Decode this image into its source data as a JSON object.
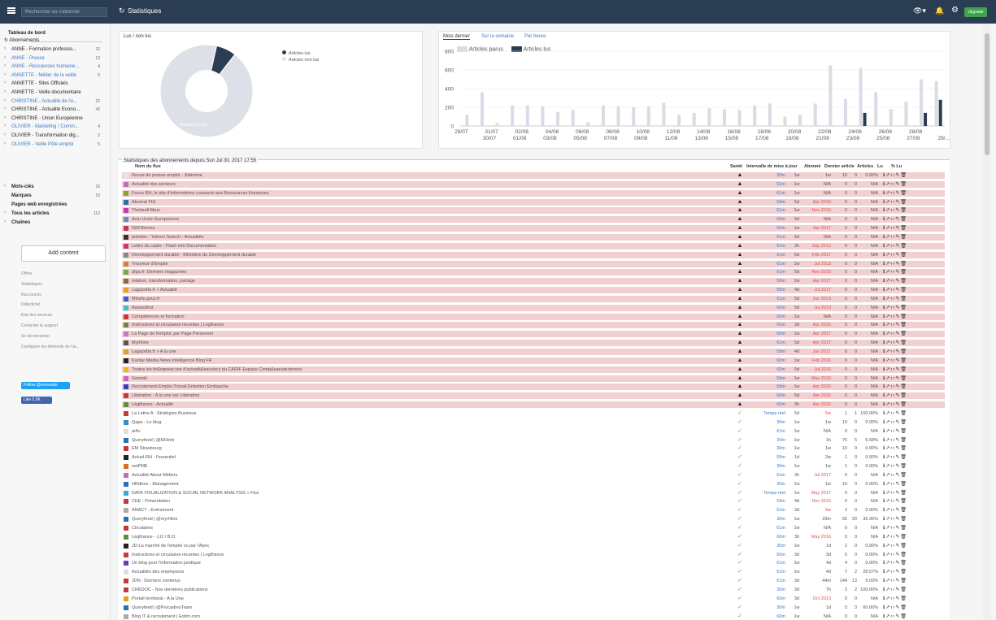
{
  "topbar": {
    "search_placeholder": "Rechercher ou s'abonner",
    "title": "Statistiques",
    "upgrade": "Upgrade"
  },
  "sidebar": {
    "dashboard": "Tableau de bord",
    "subscriptions": "Abonnements",
    "items": [
      {
        "label": "ANNE - Formation professio...",
        "count": "12",
        "style": "dark"
      },
      {
        "label": "ANNE - Presse",
        "count": "12",
        "style": "blue"
      },
      {
        "label": "ANNE - Ressources humaine...",
        "count": "4",
        "style": "blue"
      },
      {
        "label": "ANNETTE - Métier de la veille",
        "count": "5",
        "style": "blue"
      },
      {
        "label": "ANNETTE - Sites Officiels",
        "count": "",
        "style": "dark"
      },
      {
        "label": "ANNETTE - Veille documentaire",
        "count": "",
        "style": "dark"
      },
      {
        "label": "CHRISTINE - Actualité de l'e...",
        "count": "22",
        "style": "blue"
      },
      {
        "label": "CHRISTINE - Actualité Econo...",
        "count": "42",
        "style": "dark"
      },
      {
        "label": "CHRISTINE - Union Européenne",
        "count": "",
        "style": "dark"
      },
      {
        "label": "OLIVIER - Marketing / Comm...",
        "count": "4",
        "style": "blue"
      },
      {
        "label": "OLIVIER - Transformation dig...",
        "count": "2",
        "style": "dark"
      },
      {
        "label": "OLIVIER - Veille Pôle emploi",
        "count": "5",
        "style": "blue"
      }
    ],
    "keywords": "Mots-clés",
    "keywords_count": "16",
    "marks": "Marques",
    "marks_count": "10",
    "saved_pages": "Pages web enregistrées",
    "all_articles": "Tous les articles",
    "all_articles_count": "112",
    "channels": "Chaînes",
    "add_content": "Add content",
    "links": [
      "Offres",
      "Statistiques",
      "Raccourcis",
      "Didacticiel",
      "Etat des services",
      "Contacter le support",
      "Se déconnecter",
      "Configurer les éléments de l'ar..."
    ],
    "twitter": "Follow @inoreader",
    "facebook": "Like 5.9K"
  },
  "pie_panel": {
    "tab": "Lus / non lus",
    "legend_read": "Articles lus",
    "legend_unread": "Articles non lus",
    "slice_label": "Articles non lus",
    "colors": {
      "read": "#2b3d53",
      "unread": "#dde1e7"
    }
  },
  "bar_panel": {
    "tabs": [
      "Mois dernier",
      "Sur la semaine",
      "Par heure"
    ],
    "legend_published": "Articles parus",
    "legend_read": "Articles lus",
    "colors": {
      "published": "#d8dde5",
      "read": "#2b3d53"
    }
  },
  "chart_data": [
    {
      "type": "pie",
      "labels": [
        "Articles lus",
        "Articles non lus"
      ],
      "values": [
        7,
        93
      ]
    },
    {
      "type": "bar",
      "categories": [
        "29/07",
        "30/07",
        "31/07",
        "01/08",
        "02/08",
        "03/08",
        "04/08",
        "05/08",
        "06/08",
        "07/08",
        "08/08",
        "09/08",
        "10/08",
        "11/08",
        "12/08",
        "13/08",
        "14/08",
        "15/08",
        "16/08",
        "17/08",
        "18/08",
        "19/08",
        "20/08",
        "21/08",
        "22/08",
        "23/08",
        "24/08",
        "25/08",
        "26/08",
        "27/08",
        "28/08",
        "29/..."
      ],
      "ylim": [
        0,
        800
      ],
      "yticks": [
        0,
        200,
        400,
        600,
        800
      ],
      "series": [
        {
          "name": "Articles parus",
          "values": [
            120,
            360,
            30,
            220,
            220,
            210,
            150,
            170,
            40,
            220,
            210,
            200,
            210,
            250,
            120,
            140,
            190,
            180,
            170,
            220,
            240,
            100,
            120,
            240,
            650,
            290,
            620,
            360,
            180,
            260,
            500,
            480
          ]
        },
        {
          "name": "Articles lus",
          "values": [
            0,
            0,
            0,
            0,
            0,
            0,
            0,
            0,
            0,
            0,
            0,
            0,
            0,
            0,
            0,
            0,
            0,
            0,
            0,
            0,
            0,
            0,
            0,
            0,
            0,
            0,
            140,
            0,
            0,
            0,
            140,
            280
          ]
        }
      ]
    }
  ],
  "table": {
    "title": "Statistiques des abonnements depuis Sun Jul 30, 2017 17:55",
    "headers": {
      "name": "Nom du flux",
      "health": "Santé",
      "interval": "Intervalle de mise à jour",
      "sub": "Abonné",
      "last": "Dernier article",
      "articles": "Articles",
      "read": "Lu",
      "pct": "% Lu"
    },
    "rows": [
      {
        "name": "Revue de presse emploi - Jobintree",
        "health": "bad",
        "interval": "30m",
        "ab": "1w",
        "last": "1w",
        "last_red": false,
        "art": "10",
        "lu": "0",
        "pct": "0.00%",
        "icon": "#e6e6e6"
      },
      {
        "name": "Actualité des secteurs",
        "health": "bad",
        "interval": "61m",
        "ab": "1w",
        "last": "N/A",
        "last_red": false,
        "art": "0",
        "lu": "0",
        "pct": "N/A",
        "icon": "#c468c4"
      },
      {
        "name": "Focus RH, le site d'informations consacré aux Ressources Humaines",
        "health": "bad",
        "interval": "61m",
        "ab": "1w",
        "last": "N/A",
        "last_red": false,
        "art": "0",
        "lu": "0",
        "pct": "N/A",
        "icon": "#8a9f3a"
      },
      {
        "name": "Abonné FIG",
        "health": "bad",
        "interval": "59m",
        "ab": "5d",
        "last": "Apr 2016",
        "last_red": true,
        "art": "0",
        "lu": "0",
        "pct": "N/A",
        "icon": "#2a6fb5"
      },
      {
        "name": "Thebault Marc",
        "health": "bad",
        "interval": "61m",
        "ab": "1w",
        "last": "Nov 2016",
        "last_red": true,
        "art": "0",
        "lu": "0",
        "pct": "N/A",
        "icon": "#c43aa8"
      },
      {
        "name": "Actu Union Européenne",
        "health": "bad",
        "interval": "60m",
        "ab": "5d",
        "last": "N/A",
        "last_red": false,
        "art": "0",
        "lu": "0",
        "pct": "N/A",
        "icon": "#5b8fc5"
      },
      {
        "name": "ISM Brèves",
        "health": "bad",
        "interval": "60m",
        "ab": "1w",
        "last": "Jan 2017",
        "last_red": true,
        "art": "0",
        "lu": "0",
        "pct": "N/A",
        "icon": "#c43a4a"
      },
      {
        "name": "poledoc - Yahoo! Search - Actualités",
        "health": "bad",
        "interval": "61m",
        "ab": "5d",
        "last": "N/A",
        "last_red": false,
        "art": "0",
        "lu": "0",
        "pct": "N/A",
        "icon": "#333333"
      },
      {
        "name": "Lettre du cadre - Flash info Documentation",
        "health": "bad",
        "interval": "61m",
        "ab": "2h",
        "last": "Sep 2013",
        "last_red": true,
        "art": "0",
        "lu": "0",
        "pct": "N/A",
        "icon": "#c43a6a"
      },
      {
        "name": "Développement durable - Ministère du Développement durable",
        "health": "bad",
        "interval": "61m",
        "ab": "5d",
        "last": "Feb 2017",
        "last_red": true,
        "art": "0",
        "lu": "0",
        "pct": "N/A",
        "icon": "#888888"
      },
      {
        "name": "Trouveur d'Emploi",
        "health": "bad",
        "interval": "61m",
        "ab": "1w",
        "last": "Jul 2013",
        "last_red": true,
        "art": "0",
        "lu": "0",
        "pct": "N/A",
        "icon": "#c48a3a"
      },
      {
        "name": "afpa.fr: Derniers magazines",
        "health": "bad",
        "interval": "61m",
        "ab": "5d",
        "last": "Nov 2015",
        "last_red": true,
        "art": "0",
        "lu": "0",
        "pct": "N/A",
        "icon": "#6ab04c"
      },
      {
        "name": "relation, transformation, partage",
        "health": "bad",
        "interval": "59m",
        "ab": "1w",
        "last": "Apr 2017",
        "last_red": true,
        "art": "0",
        "lu": "0",
        "pct": "N/A",
        "icon": "#8a6a3a"
      },
      {
        "name": "Lagazette.fr » Actualité",
        "health": "bad",
        "interval": "59m",
        "ab": "4d",
        "last": "Jul 2017",
        "last_red": true,
        "art": "0",
        "lu": "0",
        "pct": "N/A",
        "icon": "#e0a020"
      },
      {
        "name": "Minefe.gouv.fr",
        "health": "bad",
        "interval": "61m",
        "ab": "5d",
        "last": "Jun 2013",
        "last_red": true,
        "art": "0",
        "lu": "0",
        "pct": "N/A",
        "icon": "#3a5fc5"
      },
      {
        "name": "Assessfirst",
        "health": "bad",
        "interval": "60m",
        "ab": "5d",
        "last": "Jul 2013",
        "last_red": true,
        "art": "0",
        "lu": "0",
        "pct": "N/A",
        "icon": "#3ac5c5"
      },
      {
        "name": "Compétences et formation",
        "health": "bad",
        "interval": "60m",
        "ab": "1w",
        "last": "N/A",
        "last_red": false,
        "art": "0",
        "lu": "0",
        "pct": "N/A",
        "icon": "#c43a3a"
      },
      {
        "name": "Instructions et circulaires récentes | Legifrance",
        "health": "bad",
        "interval": "60m",
        "ab": "3d",
        "last": "Apr 2016",
        "last_red": true,
        "art": "0",
        "lu": "0",
        "pct": "N/A",
        "icon": "#6a8a3a"
      },
      {
        "name": "La Page de l'emploi, par Page Personnel",
        "health": "bad",
        "interval": "60m",
        "ab": "1w",
        "last": "Apr 2017",
        "last_red": true,
        "art": "0",
        "lu": "0",
        "pct": "N/A",
        "icon": "#c47ac4"
      },
      {
        "name": "Myrhline",
        "health": "bad",
        "interval": "61m",
        "ab": "5d",
        "last": "Apr 2017",
        "last_red": true,
        "art": "0",
        "lu": "0",
        "pct": "N/A",
        "icon": "#555555"
      },
      {
        "name": "Lagazette.fr » A la une",
        "health": "bad",
        "interval": "59m",
        "ab": "4d",
        "last": "Jun 2017",
        "last_red": true,
        "art": "0",
        "lu": "0",
        "pct": "N/A",
        "icon": "#e0a020"
      },
      {
        "name": "Kantar Media News Intelligence Blog FR",
        "health": "bad",
        "interval": "60m",
        "ab": "1w",
        "last": "Feb 2016",
        "last_red": true,
        "art": "0",
        "lu": "0",
        "pct": "N/A",
        "icon": "#222222"
      },
      {
        "name": "Toutes les br&egrave;ves d'actualit&eacute;s du CARIF Espace Comp&eacute;tences",
        "health": "bad",
        "interval": "60m",
        "ab": "5d",
        "last": "Jul 2016",
        "last_red": true,
        "art": "0",
        "lu": "0",
        "pct": "N/A",
        "icon": "#e0c020"
      },
      {
        "name": "Geemik",
        "health": "bad",
        "interval": "59m",
        "ab": "1w",
        "last": "May 2016",
        "last_red": true,
        "art": "0",
        "lu": "0",
        "pct": "N/A",
        "icon": "#c468c4"
      },
      {
        "name": "Recrutement Emploi Travail Entretien Embauche",
        "health": "bad",
        "interval": "59m",
        "ab": "1w",
        "last": "Apr 2016",
        "last_red": true,
        "art": "0",
        "lu": "0",
        "pct": "N/A",
        "icon": "#3a3ac5"
      },
      {
        "name": "Libération - A la une sur Libération",
        "health": "bad",
        "interval": "60m",
        "ab": "5d",
        "last": "Apr 2016",
        "last_red": true,
        "art": "0",
        "lu": "0",
        "pct": "N/A",
        "icon": "#c43a3a"
      },
      {
        "name": "Légifrance - Actualité",
        "health": "bad",
        "interval": "60m",
        "ab": "3h",
        "last": "Apr 2016",
        "last_red": true,
        "art": "0",
        "lu": "0",
        "pct": "N/A",
        "icon": "#6a8a3a"
      },
      {
        "name": "La Lettre A : Stratégies Business",
        "health": "ok",
        "interval": "Temps réel",
        "ab": "5d",
        "last": "5w",
        "last_red": true,
        "art": "1",
        "lu": "1",
        "pct": "100.00%",
        "icon": "#c43a3a"
      },
      {
        "name": "Qapa - Le blog",
        "health": "ok",
        "interval": "30m",
        "ab": "1w",
        "last": "1w",
        "last_red": false,
        "art": "10",
        "lu": "0",
        "pct": "0.00%",
        "icon": "#3a8ac5"
      },
      {
        "name": "arftv",
        "health": "ok",
        "interval": "61m",
        "ab": "1w",
        "last": "N/A",
        "last_red": false,
        "art": "0",
        "lu": "0",
        "pct": "N/A",
        "icon": "#dddddd"
      },
      {
        "name": "Queryfeed | @RHinfo",
        "health": "ok",
        "interval": "30m",
        "ab": "1w",
        "last": "1h",
        "last_red": false,
        "art": "76",
        "lu": "5",
        "pct": "6.58%",
        "icon": "#2a6fb5"
      },
      {
        "name": "EM Strasbourg",
        "health": "ok",
        "interval": "30m",
        "ab": "1w",
        "last": "1w",
        "last_red": false,
        "art": "10",
        "lu": "0",
        "pct": "0.00%",
        "icon": "#c43a3a"
      },
      {
        "name": "Actuel-RH - l'essentiel",
        "health": "ok",
        "interval": "59m",
        "ab": "1d",
        "last": "2w",
        "last_red": false,
        "art": "1",
        "lu": "0",
        "pct": "0.00%",
        "icon": "#222222"
      },
      {
        "name": "netPME",
        "health": "ok",
        "interval": "30m",
        "ab": "1w",
        "last": "1w",
        "last_red": false,
        "art": "1",
        "lu": "0",
        "pct": "0.00%",
        "icon": "#e06a20"
      },
      {
        "name": "Actualité About Métiers",
        "health": "ok",
        "interval": "61m",
        "ab": "3h",
        "last": "Jul 2017",
        "last_red": true,
        "art": "0",
        "lu": "0",
        "pct": "N/A",
        "icon": "#c468c4"
      },
      {
        "name": "HRdtree - Management",
        "health": "ok",
        "interval": "30m",
        "ab": "1w",
        "last": "1w",
        "last_red": false,
        "art": "10",
        "lu": "0",
        "pct": "0.00%",
        "icon": "#2a6fb5"
      },
      {
        "name": "DATA VISUALIZATION & SOCIAL NETWORK ANALYSIS » Flux",
        "health": "ok",
        "interval": "Temps réel",
        "ab": "1w",
        "last": "May 2017",
        "last_red": true,
        "art": "0",
        "lu": "0",
        "pct": "N/A",
        "icon": "#3aa5e0"
      },
      {
        "name": "CEE - Présentation",
        "health": "ok",
        "interval": "59m",
        "ab": "4d",
        "last": "Dec 2015",
        "last_red": true,
        "art": "0",
        "lu": "0",
        "pct": "N/A",
        "icon": "#c43a3a"
      },
      {
        "name": "ANACT - Evènement",
        "health": "ok",
        "interval": "61m",
        "ab": "3d",
        "last": "5w",
        "last_red": true,
        "art": "2",
        "lu": "0",
        "pct": "0.00%",
        "icon": "#aaaaaa"
      },
      {
        "name": "Queryfeed | @myrhline",
        "health": "ok",
        "interval": "30m",
        "ab": "1w",
        "last": "33m",
        "last_red": false,
        "art": "55",
        "lu": "20",
        "pct": "36.36%",
        "icon": "#2a6fb5"
      },
      {
        "name": "Circulaires",
        "health": "ok",
        "interval": "61m",
        "ab": "1w",
        "last": "N/A",
        "last_red": false,
        "art": "0",
        "lu": "0",
        "pct": "N/A",
        "icon": "#c43a3a"
      },
      {
        "name": "Légifrance - J.O / B.O.",
        "health": "ok",
        "interval": "60m",
        "ab": "3h",
        "last": "May 2016",
        "last_red": true,
        "art": "0",
        "lu": "0",
        "pct": "N/A",
        "icon": "#6a8a3a"
      },
      {
        "name": "JD-La marché de l'emploi vu par l'Apec",
        "health": "ok",
        "interval": "30m",
        "ab": "1w",
        "last": "1d",
        "last_red": false,
        "art": "2",
        "lu": "0",
        "pct": "0.00%",
        "icon": "#222222"
      },
      {
        "name": "Instructions et circulaires récentes | Legifrance",
        "health": "ok",
        "interval": "60m",
        "ab": "3d",
        "last": "3d",
        "last_red": false,
        "art": "5",
        "lu": "0",
        "pct": "0.00%",
        "icon": "#c43a3a"
      },
      {
        "name": "Un blog pour l'information juridique",
        "health": "ok",
        "interval": "61m",
        "ab": "1w",
        "last": "4d",
        "last_red": false,
        "art": "4",
        "lu": "0",
        "pct": "0.00%",
        "icon": "#6a3ac5"
      },
      {
        "name": "Actualités des employeurs",
        "health": "ok",
        "interval": "61m",
        "ab": "1w",
        "last": "4d",
        "last_red": false,
        "art": "7",
        "lu": "2",
        "pct": "28.57%",
        "icon": "#dddddd"
      },
      {
        "name": "JDN : Derniers contenus",
        "health": "ok",
        "interval": "61m",
        "ab": "3d",
        "last": "44m",
        "last_red": false,
        "art": "144",
        "lu": "13",
        "pct": "9.03%",
        "icon": "#c43a3a"
      },
      {
        "name": "CRÉDOC - Nos dernières publications",
        "health": "ok",
        "interval": "30m",
        "ab": "3d",
        "last": "7h",
        "last_red": false,
        "art": "2",
        "lu": "2",
        "pct": "100.00%",
        "icon": "#c43a3a"
      },
      {
        "name": "Portail territorial - A la Une",
        "health": "ok",
        "interval": "60m",
        "ab": "3d",
        "last": "Oct 2013",
        "last_red": true,
        "art": "0",
        "lu": "0",
        "pct": "N/A",
        "icon": "#e0a020"
      },
      {
        "name": "Queryfeed | @ProcadresTeam",
        "health": "ok",
        "interval": "30m",
        "ab": "1w",
        "last": "1d",
        "last_red": false,
        "art": "5",
        "lu": "3",
        "pct": "60.00%",
        "icon": "#2a6fb5"
      },
      {
        "name": "Blog IT & recrutement | Eotim.com",
        "health": "ok",
        "interval": "60m",
        "ab": "1w",
        "last": "N/A",
        "last_red": false,
        "art": "0",
        "lu": "0",
        "pct": "N/A",
        "icon": "#aaaaaa"
      }
    ]
  }
}
